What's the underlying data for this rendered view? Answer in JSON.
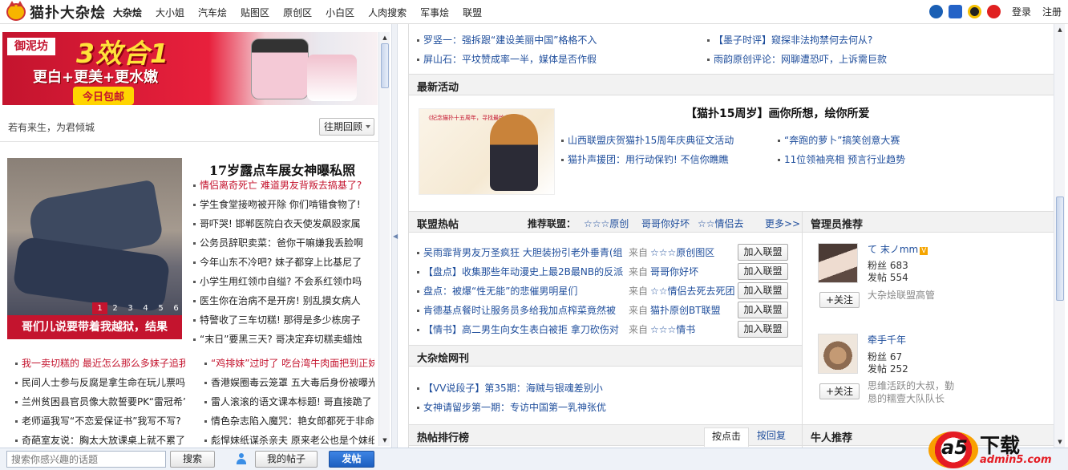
{
  "topbar": {
    "logo_text": "猫扑大杂烩",
    "nav": [
      "大杂烩",
      "大小姐",
      "汽车烩",
      "贴图区",
      "原创区",
      "小白区",
      "人肉搜索",
      "军事烩",
      "联盟"
    ],
    "active_index": 0,
    "login": "登录",
    "register": "注册"
  },
  "left": {
    "banner": {
      "brand": "御泥坊",
      "headline": "3效合1",
      "sub": "更白+更美+更水嫩",
      "pill": "今日包邮"
    },
    "motto": "若有来生，为君倾城",
    "past_button": "往期回顾",
    "slideshow": {
      "dots": [
        "1",
        "2",
        "3",
        "4",
        "5",
        "6"
      ],
      "active": 0,
      "caption": "哥们儿说要带着我越狱，结果"
    },
    "headline_title": "17岁露点车展女神曝私照",
    "headline_list": [
      {
        "text": "情侣离奇死亡 难道男友背叛去搞基了?",
        "red": true
      },
      {
        "text": "学生食堂接吻被开除 你们啃错食物了!",
        "red": false
      },
      {
        "text": "哥吓哭! 邯郸医院白衣天使发飙殴家属",
        "red": false
      },
      {
        "text": "公务员辞职卖菜：爸你干嘛嫌我丢脸啊",
        "red": false
      },
      {
        "text": "今年山东不冷吧? 妹子都穿上比基尼了",
        "red": false
      },
      {
        "text": "小学生用红领巾自缢? 不会系红领巾吗",
        "red": false
      },
      {
        "text": "医生你在治病不是开房! 别乱摸女病人",
        "red": false
      },
      {
        "text": "特警收了三车切糕! 那得是多少栋房子",
        "red": false
      },
      {
        "text": "“末日”要黑三天? 哥决定弃切糕卖蜡烛",
        "red": false
      }
    ],
    "bottom_list_a": [
      {
        "text": "我一卖切糕的 最近怎么那么多妹子追我",
        "red": true
      },
      {
        "text": "民间人士参与反腐是拿生命在玩儿票吗",
        "red": false
      },
      {
        "text": "兰州贫困县官员像大款誓要PK“雷冠希”",
        "red": false
      },
      {
        "text": "老师逼我写“不恋爱保证书”我写不写?",
        "red": false
      },
      {
        "text": "奇葩室友说：胸太大放课桌上就不累了",
        "red": false
      }
    ],
    "bottom_list_b": [
      {
        "text": "“鸡排妹”过时了 吃台湾牛肉面把到正妹",
        "red": true
      },
      {
        "text": "香港娱圈毒云笼罩 五大毒后身份被曝光",
        "red": false
      },
      {
        "text": "雷人滚滚的语文课本标题! 哥直接跪了",
        "red": false
      },
      {
        "text": "情色杂志陷入魔咒：艳女郎都死于非命",
        "red": false
      },
      {
        "text": "彪悍妹纸谋杀亲夫 原来老公也是个妹纸",
        "red": false
      }
    ]
  },
  "right": {
    "top_links_left": [
      "罗竖一：强拆跟“建设美丽中国”格格不入",
      "屏山石：平坟赞成率一半，媒体是否作假"
    ],
    "top_links_right": [
      "【墨子时评】窥探非法拘禁何去何从?",
      "雨韵原创评论：网聊遭恐吓，上诉需巨款"
    ],
    "activity": {
      "heading": "最新活动",
      "image_text": "《纪念猫扑十五周年，寻找最给力的猫》",
      "title": "【猫扑15周岁】画你所想，绘你所爱",
      "links_left": [
        "山西联盟庆贺猫扑15周年庆典征文活动",
        "猫扑声援团：用行动保钓! 不信你瞧瞧"
      ],
      "links_right": [
        "“奔跑的萝卜”搞笑创意大赛",
        "11位领袖亮相 预言行业趋势"
      ]
    },
    "alliance": {
      "heading": "联盟热帖",
      "rec_label": "推荐联盟：",
      "rec": [
        "☆☆☆原创",
        "哥哥你好坏",
        "☆☆情侣去"
      ],
      "more": "更多>>",
      "posts": [
        {
          "title": "吴雨霏背男友万圣疯狂 大胆装扮引老外垂青(组",
          "from": "来自",
          "alliance": "☆☆☆原创图区",
          "btn": "加入联盟"
        },
        {
          "title": "【盘点】收集那些年动漫史上最2B最NB的反派",
          "from": "来自",
          "alliance": "哥哥你好坏",
          "btn": "加入联盟"
        },
        {
          "title": "盘点：被爆“性无能”的悲催男明星们",
          "from": "来自",
          "alliance": "☆☆情侣去死去死团",
          "btn": "加入联盟"
        },
        {
          "title": "肯德基点餐时让服务员多给我加点榨菜竟然被",
          "from": "来自",
          "alliance": "猫扑原创BT联盟",
          "btn": "加入联盟"
        },
        {
          "title": "【情书】高二男生向女生表白被拒 拿刀砍伤对",
          "from": "来自",
          "alliance": "☆☆☆情书",
          "btn": "加入联盟"
        }
      ]
    },
    "magazine": {
      "heading": "大杂烩网刊",
      "links": [
        "【VV说段子】第35期：海贼与银魂差别小",
        "女神请留步第一期：专访中国第一乳神张优"
      ]
    },
    "ranking": {
      "heading": "热帖排行榜",
      "tabs": [
        "按点击",
        "按回复"
      ],
      "active": 0
    },
    "admin": {
      "heading": "管理员推荐",
      "users": [
        {
          "name": "て      末ノmm",
          "vip": "V",
          "fans_label": "粉丝",
          "fans": "683",
          "posts_label": "发帖",
          "posts": "554",
          "desc": "大杂烩联盟高管",
          "follow": "+关注"
        },
        {
          "name": "牵手千年",
          "vip": "",
          "fans_label": "粉丝",
          "fans": "67",
          "posts_label": "发帖",
          "posts": "252",
          "desc": "思维活跃的大叔，勤恳的糯壹大队队长",
          "follow": "+关注"
        }
      ]
    },
    "niuren_heading": "牛人推荐"
  },
  "bottom": {
    "search_placeholder": "搜索你感兴趣的话题",
    "search_btn": "搜索",
    "my_posts": "我的帖子",
    "post_btn": "发帖"
  },
  "watermark": {
    "mark": "a5",
    "text": "下载",
    "url": "admin5.com"
  },
  "colors": {
    "accent_red": "#c4142e",
    "link_blue": "#1f4e9c",
    "post_blue": "#1d5fc0"
  }
}
